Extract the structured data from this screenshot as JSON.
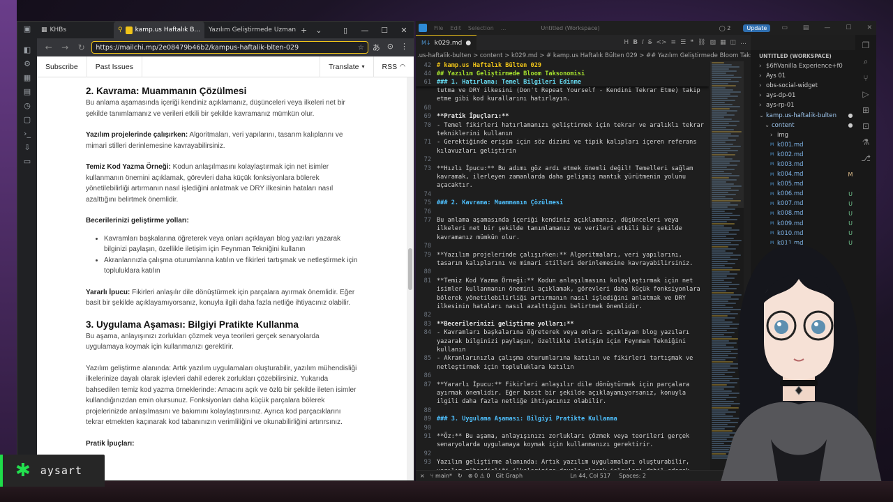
{
  "browser": {
    "tabs": [
      {
        "label": "KHBs",
        "icon": "grid-icon"
      },
      {
        "label": "kamp.us Haftalık B...",
        "icon": "pin-icon"
      },
      {
        "label": "Yazılım Geliştirmede Uzmanla..."
      }
    ],
    "url": "https://mailchi.mp/2e08479b46b2/kampus-haftalik-blten-029",
    "nav": {
      "subscribe": "Subscribe",
      "past_issues": "Past Issues",
      "translate": "Translate",
      "rss": "RSS"
    },
    "article": {
      "h2_kavrama": "2. Kavrama: Muammanın Çözülmesi",
      "p_kavrama": "Bu anlama aşamasında içeriği kendiniz açıklamanız, düşünceleri veya ilkeleri net bir şekilde tanımlamanız ve verileri etkili bir şekilde kavramanız mümkün olur.",
      "p_projeler_bold": "Yazılım projelerinde çalışırken:",
      "p_projeler": " Algoritmaları, veri yapılarını, tasarım kalıplarını ve mimari stilleri derinlemesine kavrayabilirsiniz.",
      "p_temiz_bold": "Temiz Kod Yazma Örneği:",
      "p_temiz": " Kodun anlaşılmasını kolaylaştırmak için net isimler kullanmanın önemini açıklamak, görevleri daha küçük fonksiyonlara bölerek yönetilebilirliği artırmanın nasıl işlediğini anlatmak ve DRY ilkesinin hataları nasıl azalttığını belirtmek önemlidir.",
      "p_beceriler_bold": "Becerilerinizi geliştirme yolları:",
      "li_1": "Kavramları başkalarına öğreterek veya onları açıklayan blog yazıları yazarak bilginizi paylaşın, özellikle iletişim için Feynman Tekniğini kullanın",
      "li_2": "Akranlarınızla çalışma oturumlarına katılın ve fikirleri tartışmak ve netleştirmek için topluluklara katılın",
      "p_ipucu_bold": "Yararlı İpucu:",
      "p_ipucu": " Fikirleri anlaşılır dile dönüştürmek için parçalara ayırmak önemlidir. Eğer basit bir şekilde açıklayamıyorsanız, konuyla ilgili daha fazla netliğe ihtiyacınız olabilir.",
      "h2_uygulama": "3. Uygulama Aşaması: Bilgiyi Pratikte Kullanma",
      "p_uygulama": "Bu aşama, anlayışınızı zorlukları çözmek veya teorileri gerçek senaryolarda uygulamaya koymak için kullanmanızı gerektirir.",
      "p_gelistirme": "Yazılım geliştirme alanında: Artık yazılım uygulamaları oluşturabilir, yazılım mühendisliği ilkelerinize dayalı olarak işlevleri dahil ederek zorlukları çözebilirsiniz. Yukarıda bahsedilen temiz kod yazma örneklerinde: Amacını açık ve özlü bir şekilde ileten isimler kullandığınızdan emin olursunuz. Fonksiyonları daha küçük parçalara bölerek projelerinizde anlaşılmasını ve bakımını kolaylaştırırsınız. Ayrıca kod parçacıklarını tekrar etmekten kaçınarak kod tabanınızın verimliliğini ve okunabilirliğini artırırsınız.",
      "p_pratik_bold": "Pratik İpuçları:"
    }
  },
  "vscode": {
    "menu": [
      "File",
      "Edit",
      "Selection",
      "..."
    ],
    "workspace_title": "Untitled (Workspace)",
    "accounts_badge": "2",
    "update_label": "Update",
    "tab_label": "k029.md",
    "breadcrumb": ".us-haftalik-bulten  >  content  >  k029.md  >  # kamp.us Haftalık Bülten 029  >  ## Yazılım Geliştirmede Bloom Taksonomisi",
    "sticky": [
      {
        "n": "42",
        "t": "# kamp.us Haftalık Bülten 029",
        "c": "h1"
      },
      {
        "n": "44",
        "t": "## Yazılım Geliştirmede Bloom Taksonomisi",
        "c": "green-h"
      },
      {
        "n": "61",
        "t": "### 1. Hatırlama: Temel Bilgileri Edinme",
        "c": "sticky-h"
      }
    ],
    "lines": [
      {
        "n": "",
        "t": "tutma ve DRY ilkesini (Don't Repeat Yourself - Kendini Tekrar Etme) takip",
        "c": ""
      },
      {
        "n": "",
        "t": "etme gibi kod kurallarını hatırlayın.",
        "c": ""
      },
      {
        "n": "68",
        "t": "",
        "c": ""
      },
      {
        "n": "69",
        "t": "**Pratik İpuçları:**",
        "c": "bold"
      },
      {
        "n": "70",
        "t": "- Temel fikirleri hatırlamanızı geliştirmek için tekrar ve aralıklı tekrar",
        "c": ""
      },
      {
        "n": "",
        "t": "tekniklerini kullanın",
        "c": ""
      },
      {
        "n": "71",
        "t": "- Gerektiğinde erişim için söz dizimi ve tipik kalıpları içeren referans",
        "c": ""
      },
      {
        "n": "",
        "t": "kılavuzları geliştirin",
        "c": ""
      },
      {
        "n": "72",
        "t": "",
        "c": ""
      },
      {
        "n": "73",
        "t": "**Hızlı İpucu:** Bu adımı göz ardı etmek önemli değil! Temelleri sağlam",
        "c": ""
      },
      {
        "n": "",
        "t": "kavramak, ilerleyen zamanlarda daha gelişmiş mantık yürütmenin yolunu",
        "c": ""
      },
      {
        "n": "",
        "t": "açacaktır.",
        "c": ""
      },
      {
        "n": "74",
        "t": "",
        "c": ""
      },
      {
        "n": "75",
        "t": "### 2. Kavrama: Muammanın Çözülmesi",
        "c": "h"
      },
      {
        "n": "76",
        "t": "",
        "c": ""
      },
      {
        "n": "77",
        "t": "Bu anlama aşamasında içeriği kendiniz açıklamanız, düşünceleri veya",
        "c": ""
      },
      {
        "n": "",
        "t": "ilkeleri net bir şekilde tanımlamanız ve verileri etkili bir şekilde",
        "c": ""
      },
      {
        "n": "",
        "t": "kavramanız mümkün olur.",
        "c": ""
      },
      {
        "n": "78",
        "t": "",
        "c": ""
      },
      {
        "n": "79",
        "t": "**Yazılım projelerinde çalışırken:** Algoritmaları, veri yapılarını,",
        "c": ""
      },
      {
        "n": "",
        "t": "tasarım kalıplarını ve mimari stilleri derinlemesine kavrayabilirsiniz.",
        "c": ""
      },
      {
        "n": "80",
        "t": "",
        "c": ""
      },
      {
        "n": "81",
        "t": "**Temiz Kod Yazma Örneği:** Kodun anlaşılmasını kolaylaştırmak için net",
        "c": ""
      },
      {
        "n": "",
        "t": "isimler kullanmanın önemini açıklamak, görevleri daha küçük fonksiyonlara",
        "c": ""
      },
      {
        "n": "",
        "t": "bölerek yönetilebilirliği artırmanın nasıl işlediğini anlatmak ve DRY",
        "c": ""
      },
      {
        "n": "",
        "t": "ilkesinin hataları nasıl azalttığını belirtmek önemlidir.",
        "c": ""
      },
      {
        "n": "82",
        "t": "",
        "c": ""
      },
      {
        "n": "83",
        "t": "**Becerilerinizi geliştirme yolları:**",
        "c": "bold"
      },
      {
        "n": "84",
        "t": "- Kavramları başkalarına öğreterek veya onları açıklayan blog yazıları",
        "c": ""
      },
      {
        "n": "",
        "t": "yazarak bilginizi paylaşın, özellikle iletişim için Feynman Tekniğini",
        "c": ""
      },
      {
        "n": "",
        "t": "kullanın",
        "c": ""
      },
      {
        "n": "85",
        "t": "- Akranlarınızla çalışma oturumlarına katılın ve fikirleri tartışmak ve",
        "c": ""
      },
      {
        "n": "",
        "t": "netleştirmek için topluluklara katılın",
        "c": ""
      },
      {
        "n": "86",
        "t": "",
        "c": ""
      },
      {
        "n": "87",
        "t": "**Yararlı İpucu:** Fikirleri anlaşılır dile dönüştürmek için parçalara",
        "c": ""
      },
      {
        "n": "",
        "t": "ayırmak önemlidir. Eğer basit bir şekilde açıklayamıyorsanız, konuyla",
        "c": ""
      },
      {
        "n": "",
        "t": "ilgili daha fazla netliğe ihtiyacınız olabilir.",
        "c": ""
      },
      {
        "n": "88",
        "t": "",
        "c": ""
      },
      {
        "n": "89",
        "t": "### 3. Uygulama Aşaması: Bilgiyi Pratikte Kullanma",
        "c": "h"
      },
      {
        "n": "90",
        "t": "",
        "c": ""
      },
      {
        "n": "91",
        "t": "**Öz:** Bu aşama, anlayışınızı zorlukları çözmek veya teorileri gerçek",
        "c": ""
      },
      {
        "n": "",
        "t": "senaryolarda uygulamaya koymak için kullanmanızı gerektirir.",
        "c": ""
      },
      {
        "n": "92",
        "t": "",
        "c": ""
      },
      {
        "n": "93",
        "t": "Yazılım geliştirme alanında: Artık yazılım uygulamaları oluşturabilir,",
        "c": ""
      },
      {
        "n": "",
        "t": "yazılım mühendisliği ilkelerinize dayalı olarak işlevleri dahil ederek",
        "c": ""
      }
    ],
    "explorer_title": "UNTITLED (WORKSPACE)",
    "explorer": [
      {
        "label": "$6fiVanilla Experience+f0",
        "indent": 12,
        "type": "folder",
        "status": "",
        "dim": true
      },
      {
        "label": "Ays 01",
        "indent": 12,
        "type": "folder",
        "status": ""
      },
      {
        "label": "obs-social-widget",
        "indent": 12,
        "type": "folder",
        "status": ""
      },
      {
        "label": "ays-dp-01",
        "indent": 12,
        "type": "folder",
        "status": ""
      },
      {
        "label": "ays-rp-01",
        "indent": 12,
        "type": "folder",
        "status": ""
      },
      {
        "label": "kamp.us-haftalik-bulten",
        "indent": 12,
        "type": "folder-open",
        "status": "●",
        "sel": true
      },
      {
        "label": "content",
        "indent": 20,
        "type": "folder-open",
        "status": "●",
        "sel": true
      },
      {
        "label": "img",
        "indent": 28,
        "type": "folder",
        "status": ""
      },
      {
        "label": "k001.md",
        "indent": 28,
        "type": "md",
        "status": ""
      },
      {
        "label": "k002.md",
        "indent": 28,
        "type": "md",
        "status": ""
      },
      {
        "label": "k003.md",
        "indent": 28,
        "type": "md",
        "status": ""
      },
      {
        "label": "k004.md",
        "indent": 28,
        "type": "md",
        "status": "M"
      },
      {
        "label": "k005.md",
        "indent": 28,
        "type": "md",
        "status": ""
      },
      {
        "label": "k006.md",
        "indent": 28,
        "type": "md",
        "status": "U"
      },
      {
        "label": "k007.md",
        "indent": 28,
        "type": "md",
        "status": "U"
      },
      {
        "label": "k008.md",
        "indent": 28,
        "type": "md",
        "status": "U"
      },
      {
        "label": "k009.md",
        "indent": 28,
        "type": "md",
        "status": "U"
      },
      {
        "label": "k010.md",
        "indent": 28,
        "type": "md",
        "status": "U"
      },
      {
        "label": "k011.md",
        "indent": 28,
        "type": "md",
        "status": "U"
      }
    ],
    "status": {
      "branch": "main*",
      "problems": "⊗ 0 ⚠ 0",
      "git_graph": "Git Graph",
      "position": "Ln 44, Col 517",
      "spaces": "Spaces: 2"
    }
  },
  "badge": {
    "name": "aysart",
    "logo_color": "#22e04e"
  }
}
